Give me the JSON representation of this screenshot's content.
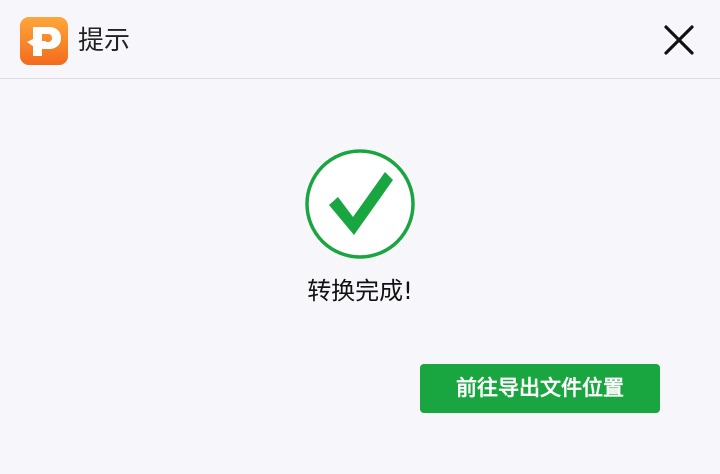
{
  "titlebar": {
    "title": "提示",
    "logo_icon": "app-logo-icon",
    "close_icon": "close-icon"
  },
  "content": {
    "status_icon": "success-check-icon",
    "message": "转换完成!"
  },
  "actions": {
    "open_location_label": "前往导出文件位置"
  },
  "colors": {
    "brand_orange": "#f26b1d",
    "success_green": "#19a540",
    "background": "#f7f7fb"
  }
}
